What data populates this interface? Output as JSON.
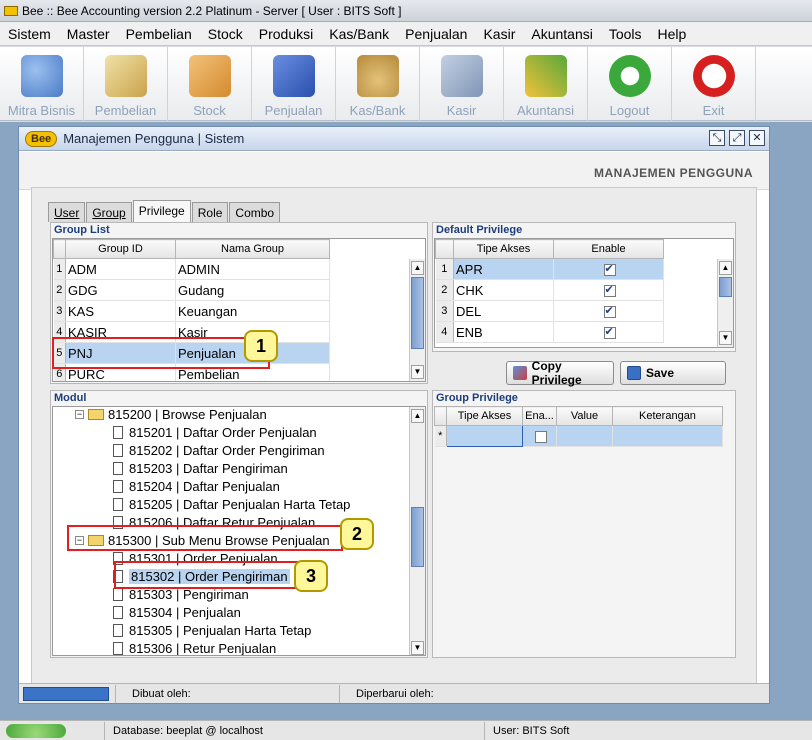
{
  "window": {
    "title": "Bee :: Bee Accounting version 2.2 Platinum - Server  [ User : BITS Soft ]"
  },
  "menu": [
    "Sistem",
    "Master",
    "Pembelian",
    "Stock",
    "Produksi",
    "Kas/Bank",
    "Penjualan",
    "Kasir",
    "Akuntansi",
    "Tools",
    "Help"
  ],
  "toolbar": [
    {
      "label": "Mitra Bisnis",
      "icon": "people-icon",
      "color": "#4a7bc8"
    },
    {
      "label": "Pembelian",
      "icon": "purchase-icon",
      "color": "#c9a24a"
    },
    {
      "label": "Stock",
      "icon": "boxes-icon",
      "color": "#d58a2e"
    },
    {
      "label": "Penjualan",
      "icon": "shopping-bag-icon",
      "color": "#2a4fae"
    },
    {
      "label": "Kas/Bank",
      "icon": "money-bag-icon",
      "color": "#b58a3a"
    },
    {
      "label": "Kasir",
      "icon": "cart-icon",
      "color": "#7f95b6"
    },
    {
      "label": "Akuntansi",
      "icon": "chart-icon",
      "color": "#5aa83a"
    },
    {
      "label": "Logout",
      "icon": "logout-icon",
      "color": "#3aa83a"
    },
    {
      "label": "Exit",
      "icon": "power-icon",
      "color": "#d62020"
    }
  ],
  "child_window": {
    "logo": "Bee",
    "title": "Manajemen Pengguna | Sistem",
    "heading": "MANAJEMEN PENGGUNA"
  },
  "tabs": [
    {
      "label": "User",
      "active": false
    },
    {
      "label": "Group",
      "active": false
    },
    {
      "label": "Privilege",
      "active": true
    },
    {
      "label": "Role",
      "active": false
    },
    {
      "label": "Combo",
      "active": false
    }
  ],
  "group_list": {
    "title": "Group List",
    "columns": [
      "Group ID",
      "Nama Group"
    ],
    "rows": [
      {
        "n": "1",
        "id": "ADM",
        "name": "ADMIN"
      },
      {
        "n": "2",
        "id": "GDG",
        "name": "Gudang"
      },
      {
        "n": "3",
        "id": "KAS",
        "name": "Keuangan"
      },
      {
        "n": "4",
        "id": "KASIR",
        "name": "Kasir"
      },
      {
        "n": "5",
        "id": "PNJ",
        "name": "Penjualan"
      },
      {
        "n": "6",
        "id": "PURC",
        "name": "Pembelian"
      }
    ]
  },
  "default_privilege": {
    "title": "Default Privilege",
    "columns": [
      "Tipe Akses",
      "Enable"
    ],
    "rows": [
      {
        "n": "1",
        "type": "APR",
        "enabled": true
      },
      {
        "n": "2",
        "type": "CHK",
        "enabled": true
      },
      {
        "n": "3",
        "type": "DEL",
        "enabled": true
      },
      {
        "n": "4",
        "type": "ENB",
        "enabled": true
      }
    ]
  },
  "buttons": {
    "copy_privilege": "Copy Privilege",
    "save": "Save"
  },
  "modul": {
    "title": "Modul",
    "nodes": [
      {
        "label": "815200 | Browse Penjualan",
        "kind": "folder"
      },
      {
        "label": "815201 | Daftar Order Penjualan",
        "kind": "doc"
      },
      {
        "label": "815202 | Daftar Order Pengiriman",
        "kind": "doc"
      },
      {
        "label": "815203 | Daftar Pengiriman",
        "kind": "doc"
      },
      {
        "label": "815204 | Daftar Penjualan",
        "kind": "doc"
      },
      {
        "label": "815205 | Daftar Penjualan Harta Tetap",
        "kind": "doc"
      },
      {
        "label": "815206 | Daftar Retur Penjualan",
        "kind": "doc"
      },
      {
        "label": "815300 | Sub Menu Browse Penjualan",
        "kind": "folder"
      },
      {
        "label": "815301 | Order Penjualan",
        "kind": "doc"
      },
      {
        "label": "815302 | Order Pengiriman",
        "kind": "doc"
      },
      {
        "label": "815303 | Pengiriman",
        "kind": "doc"
      },
      {
        "label": "815304 | Penjualan",
        "kind": "doc"
      },
      {
        "label": "815305 | Penjualan Harta Tetap",
        "kind": "doc"
      },
      {
        "label": "815306 | Retur Penjualan",
        "kind": "doc"
      }
    ]
  },
  "group_privilege": {
    "title": "Group Privilege",
    "columns": [
      "Tipe Akses",
      "Ena...",
      "Value",
      "Keterangan"
    ],
    "new_row_marker": "*"
  },
  "callouts": [
    "1",
    "2",
    "3"
  ],
  "child_status": {
    "created_by": "Dibuat oleh:",
    "updated_by": "Diperbarui oleh:"
  },
  "app_status": {
    "database": "Database: beeplat @ localhost",
    "user": "User: BITS Soft"
  }
}
